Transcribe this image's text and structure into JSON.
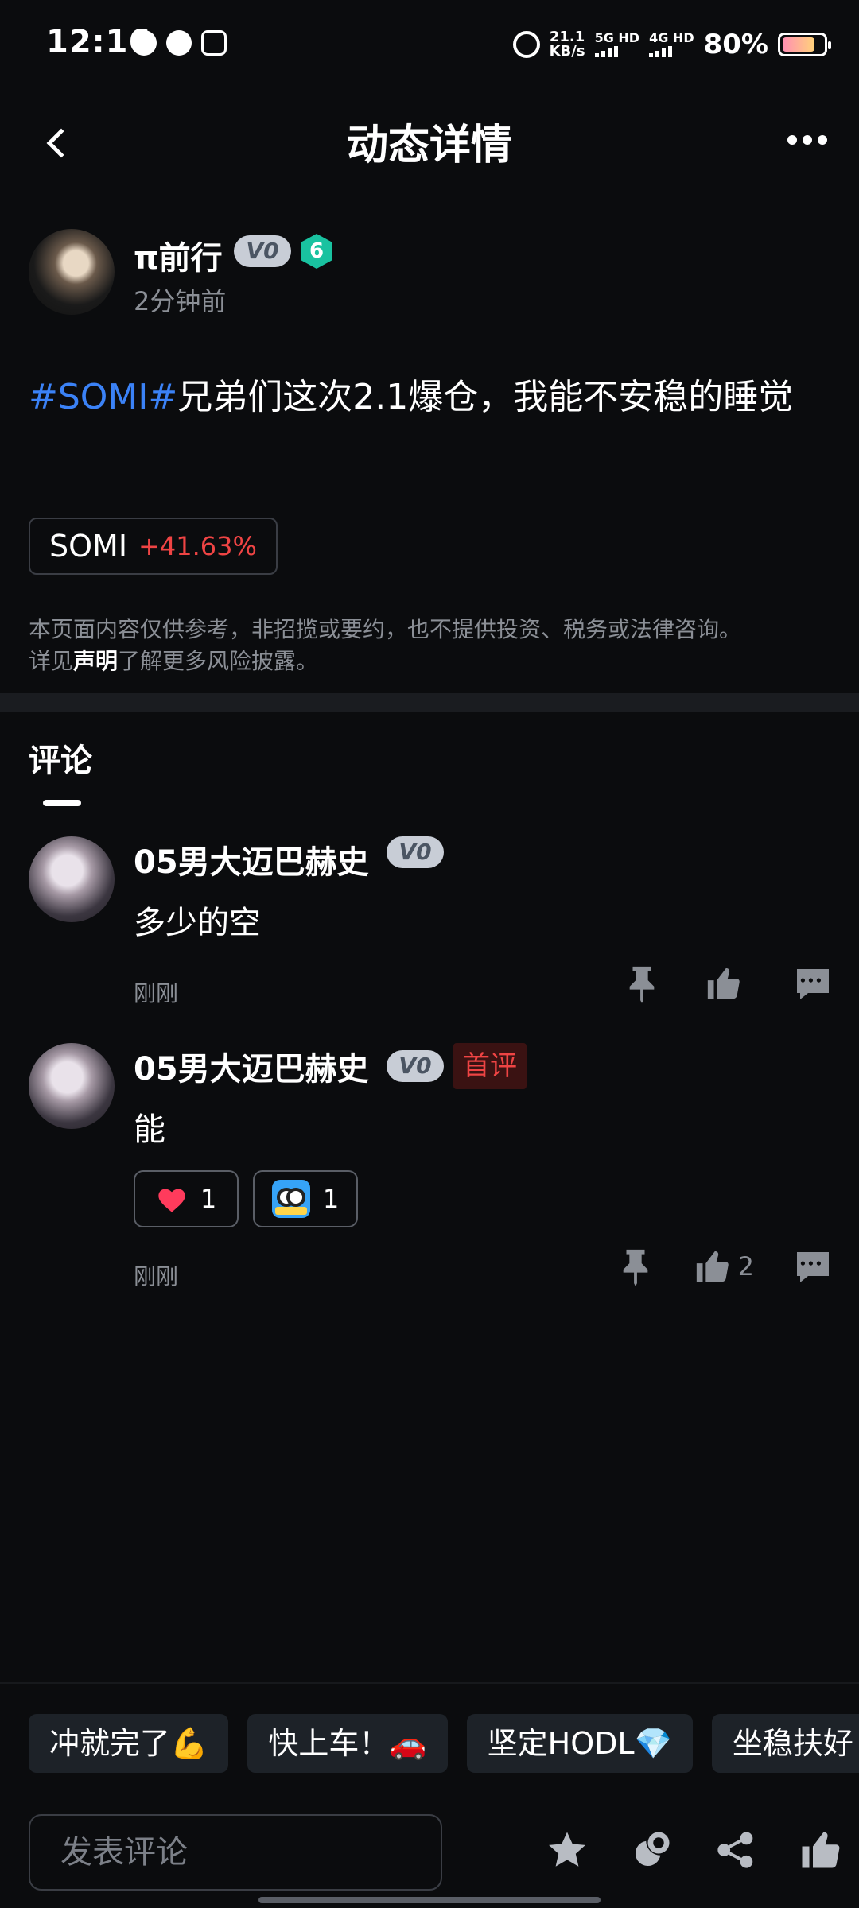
{
  "status_bar": {
    "time": "12:16",
    "speed": "21.1",
    "speed_unit": "KB/s",
    "net1": "5G HD",
    "net2": "4G HD",
    "battery": "80%"
  },
  "header": {
    "title": "动态详情"
  },
  "post": {
    "author": {
      "name": "π前行",
      "vip_badge": "V0",
      "level": "6",
      "time": "2分钟前"
    },
    "hashtag": "#SOMI#",
    "text": "兄弟们这次2.1爆仓，我能不安稳的睡觉",
    "coin": {
      "symbol": "SOMI",
      "change": "+41.63%",
      "change_color": "#ef4444"
    },
    "disclaimer": {
      "line1": "本页面内容仅供参考，非招揽或要约，也不提供投资、税务或法律咨询。",
      "pre": "详见",
      "link": "声明",
      "post": "了解更多风险披露。"
    }
  },
  "comments_section": {
    "tab_label": "评论",
    "comments": [
      {
        "name": "05男大迈巴赫史",
        "vip_badge": "V0",
        "text": "多少的空",
        "time": "刚刚",
        "like_count": ""
      },
      {
        "name": "05男大迈巴赫史",
        "vip_badge": "V0",
        "first_badge": "首评",
        "text": "能",
        "reactions": [
          {
            "icon": "heart-icon",
            "count": "1"
          },
          {
            "icon": "hodl-owl-icon",
            "count": "1"
          }
        ],
        "time": "刚刚",
        "like_count": "2"
      }
    ]
  },
  "quick_replies": [
    "冲就完了💪",
    "快上车！🚗",
    "坚定HODL💎",
    "坐稳扶好"
  ],
  "bottom_bar": {
    "input_placeholder": "发表评论",
    "icons": [
      "star-icon",
      "tip-coin-icon",
      "share-icon",
      "thumbs-up-icon"
    ]
  },
  "colors": {
    "background": "#0b0c0e",
    "hashtag": "#3b82f6",
    "negative_red": "#ef4444",
    "level_badge": "#19c2a0"
  }
}
